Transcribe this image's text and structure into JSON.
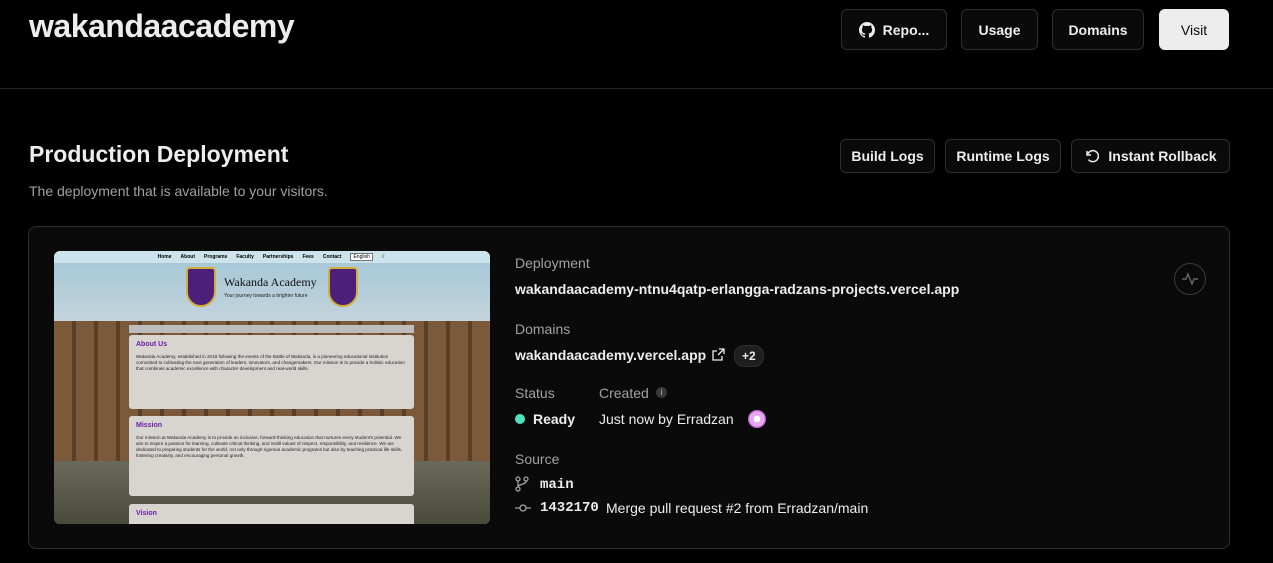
{
  "header": {
    "project_name": "wakandaacademy",
    "buttons": {
      "repo": "Repo...",
      "usage": "Usage",
      "domains": "Domains",
      "visit": "Visit"
    }
  },
  "production": {
    "title": "Production Deployment",
    "subtitle": "The deployment that is available to your visitors.",
    "buttons": {
      "build_logs": "Build Logs",
      "runtime_logs": "Runtime Logs",
      "instant_rollback": "Instant Rollback"
    }
  },
  "deployment": {
    "deployment_label": "Deployment",
    "deployment_url": "wakandaacademy-ntnu4qatp-erlangga-radzans-projects.vercel.app",
    "domains_label": "Domains",
    "domain": "wakandaacademy.vercel.app",
    "domains_extra": "+2",
    "status_label": "Status",
    "status_value": "Ready",
    "status_color": "#50e3c2",
    "created_label": "Created",
    "created_value": "Just now by Erradzan",
    "source_label": "Source",
    "branch": "main",
    "commit_hash": "1432170",
    "commit_message": "Merge pull request #2 from Erradzan/main"
  },
  "preview": {
    "nav": [
      "Home",
      "About",
      "Programs",
      "Faculty",
      "Partnerships",
      "Fees",
      "Contact"
    ],
    "language": "English",
    "site_title": "Wakanda Academy",
    "tagline": "Your journey towards a brighter future",
    "about_heading": "About Us",
    "about_text": "Wakanda Academy, established in 2018 following the events of the Battle of Wakanda, is a pioneering educational institution committed to cultivating the next generation of leaders, innovators, and changemakers. Our mission is to provide a holistic education that combines academic excellence with character development and real-world skills.",
    "mission_heading": "Mission",
    "mission_text": "Our mission at Wakanda Academy is to provide an inclusive, forward-thinking education that nurtures every student's potential. We aim to inspire a passion for learning, cultivate critical thinking, and instill values of respect, responsibility, and resilience. We are dedicated to preparing students for the world, not only through rigorous academic programs but also by teaching practical life skills, fostering creativity, and encouraging personal growth.",
    "vision_heading": "Vision"
  }
}
